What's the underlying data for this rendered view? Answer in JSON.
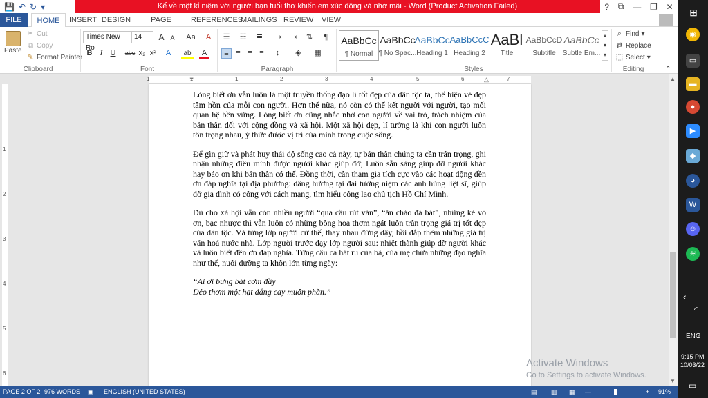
{
  "window": {
    "title": "Kể về một kỉ niệm với người bạn tuổi thơ khiến em xúc động và nhớ mãi - Word (Product Activation Failed)",
    "title_color": "#e81123",
    "controls": [
      "?",
      "⧉",
      "—",
      "❐",
      "✕"
    ]
  },
  "qat": {
    "save": "💾",
    "undo": "↶",
    "redo": "↻",
    "more": "▾"
  },
  "tabs": [
    {
      "label": "FILE"
    },
    {
      "label": "HOME"
    },
    {
      "label": "INSERT"
    },
    {
      "label": "DESIGN"
    },
    {
      "label": "PAGE LAYOUT"
    },
    {
      "label": "REFERENCES"
    },
    {
      "label": "MAILINGS"
    },
    {
      "label": "REVIEW"
    },
    {
      "label": "VIEW"
    }
  ],
  "accent": "#2b579a",
  "clipboard": {
    "paste": "Paste",
    "cut": "Cut",
    "copy": "Copy",
    "format_painter": "Format Painter",
    "label": "Clipboard"
  },
  "font": {
    "name": "Times New Ro",
    "size": "14",
    "label": "Font",
    "bold": "B",
    "italic": "I",
    "underline": "U",
    "strike": "abc",
    "sub": "x₂",
    "sup": "x²",
    "grow": "A",
    "shrink": "A",
    "case": "Aa",
    "clear": "A",
    "effects": "A",
    "highlight": "ab",
    "color": "A"
  },
  "paragraph": {
    "label": "Paragraph"
  },
  "styles": {
    "label": "Styles",
    "items": [
      {
        "sample": "AaBbCc",
        "name": "¶ Normal"
      },
      {
        "sample": "AaBbCc",
        "name": "¶ No Spac..."
      },
      {
        "sample": "AaBbCc",
        "name": "Heading 1"
      },
      {
        "sample": "AaBbCcC",
        "name": "Heading 2"
      },
      {
        "sample": "AaBl",
        "name": "Title"
      },
      {
        "sample": "AaBbCcD",
        "name": "Subtitle"
      },
      {
        "sample": "AaBbCc",
        "name": "Subtle Em..."
      }
    ]
  },
  "editing": {
    "label": "Editing",
    "find": "Find",
    "replace": "Replace",
    "select": "Select"
  },
  "ruler": {
    "numbers": [
      "1",
      "1",
      "2",
      "3",
      "4",
      "5",
      "6",
      "7"
    ],
    "left_numbers": [
      "1",
      "2",
      "3",
      "4",
      "5",
      "6"
    ]
  },
  "document": {
    "paragraphs": [
      "Lòng biết ơn vẫn luôn là một truyền thống đạo lí tốt đẹp của dân tộc ta, thể hiện vẻ đẹp tâm hồn của mỗi con người. Hơn thế nữa, nó còn có thể kết người với người, tạo mối quan hệ bền vững. Lòng biết ơn cũng nhắc nhở con người về vai trò, trách nhiệm của bản thân đối với cộng đồng và xã hội. Một xã hội đẹp, lí tưởng là khi con người luôn tôn trọng nhau, ý thức được vị trí của mình trong cuộc sống.",
      "Để gìn giữ và phát huy thái độ sống cao cả này, tự bản thân chúng ta cần trân trọng, ghi nhận những điều mình được người khác giúp đỡ; Luôn sẵn sàng giúp đỡ người khác hay báo ơn khi bản thân có thể. Đồng thời, cần tham gia tích cực vào các hoạt động đền ơn đáp nghĩa tại địa phương: dâng hương tại đài tưởng niệm các anh hùng liệt sĩ, giúp đỡ gia đình có công với cách mạng, tìm hiểu công lao chủ tịch Hồ Chí Minh.",
      "Dù cho xã hội vẫn còn nhiều người “qua cầu rút ván”, “ăn cháo đá bát”, những kẻ vô ơn, bạc nhược thì vẫn luôn có những bông hoa thơm ngát luôn trân trọng giá trị tốt đẹp của dân tộc. Và từng lớp người cứ thế, thay nhau đứng dậy, bồi đắp thêm những giá trị văn hoá nước nhà. Lớp người trước dạy lớp người sau: nhiệt thành giúp đỡ người khác và luôn biết đền ơn đáp nghĩa. Từng câu ca hát ru của bà, của mẹ chứa những đạo nghĩa như thế, nuôi dưỡng ta khôn lớn từng ngày:"
    ],
    "poem": [
      "“Ai ơi bưng bát cơm đầy",
      "Dẻo thơm một hạt đắng cay muôn phần.”"
    ]
  },
  "status": {
    "page": "PAGE 2 OF 2",
    "words": "976 WORDS",
    "language": "ENGLISH (UNITED STATES)",
    "zoom": "91%"
  },
  "watermark": {
    "title": "Activate Windows",
    "subtitle": "Go to Settings to activate Windows."
  },
  "taskbar": {
    "lang": "ENG",
    "time": "9:15 PM",
    "date": "10/03/22",
    "chevron": "‹",
    "wifi": "◜"
  }
}
